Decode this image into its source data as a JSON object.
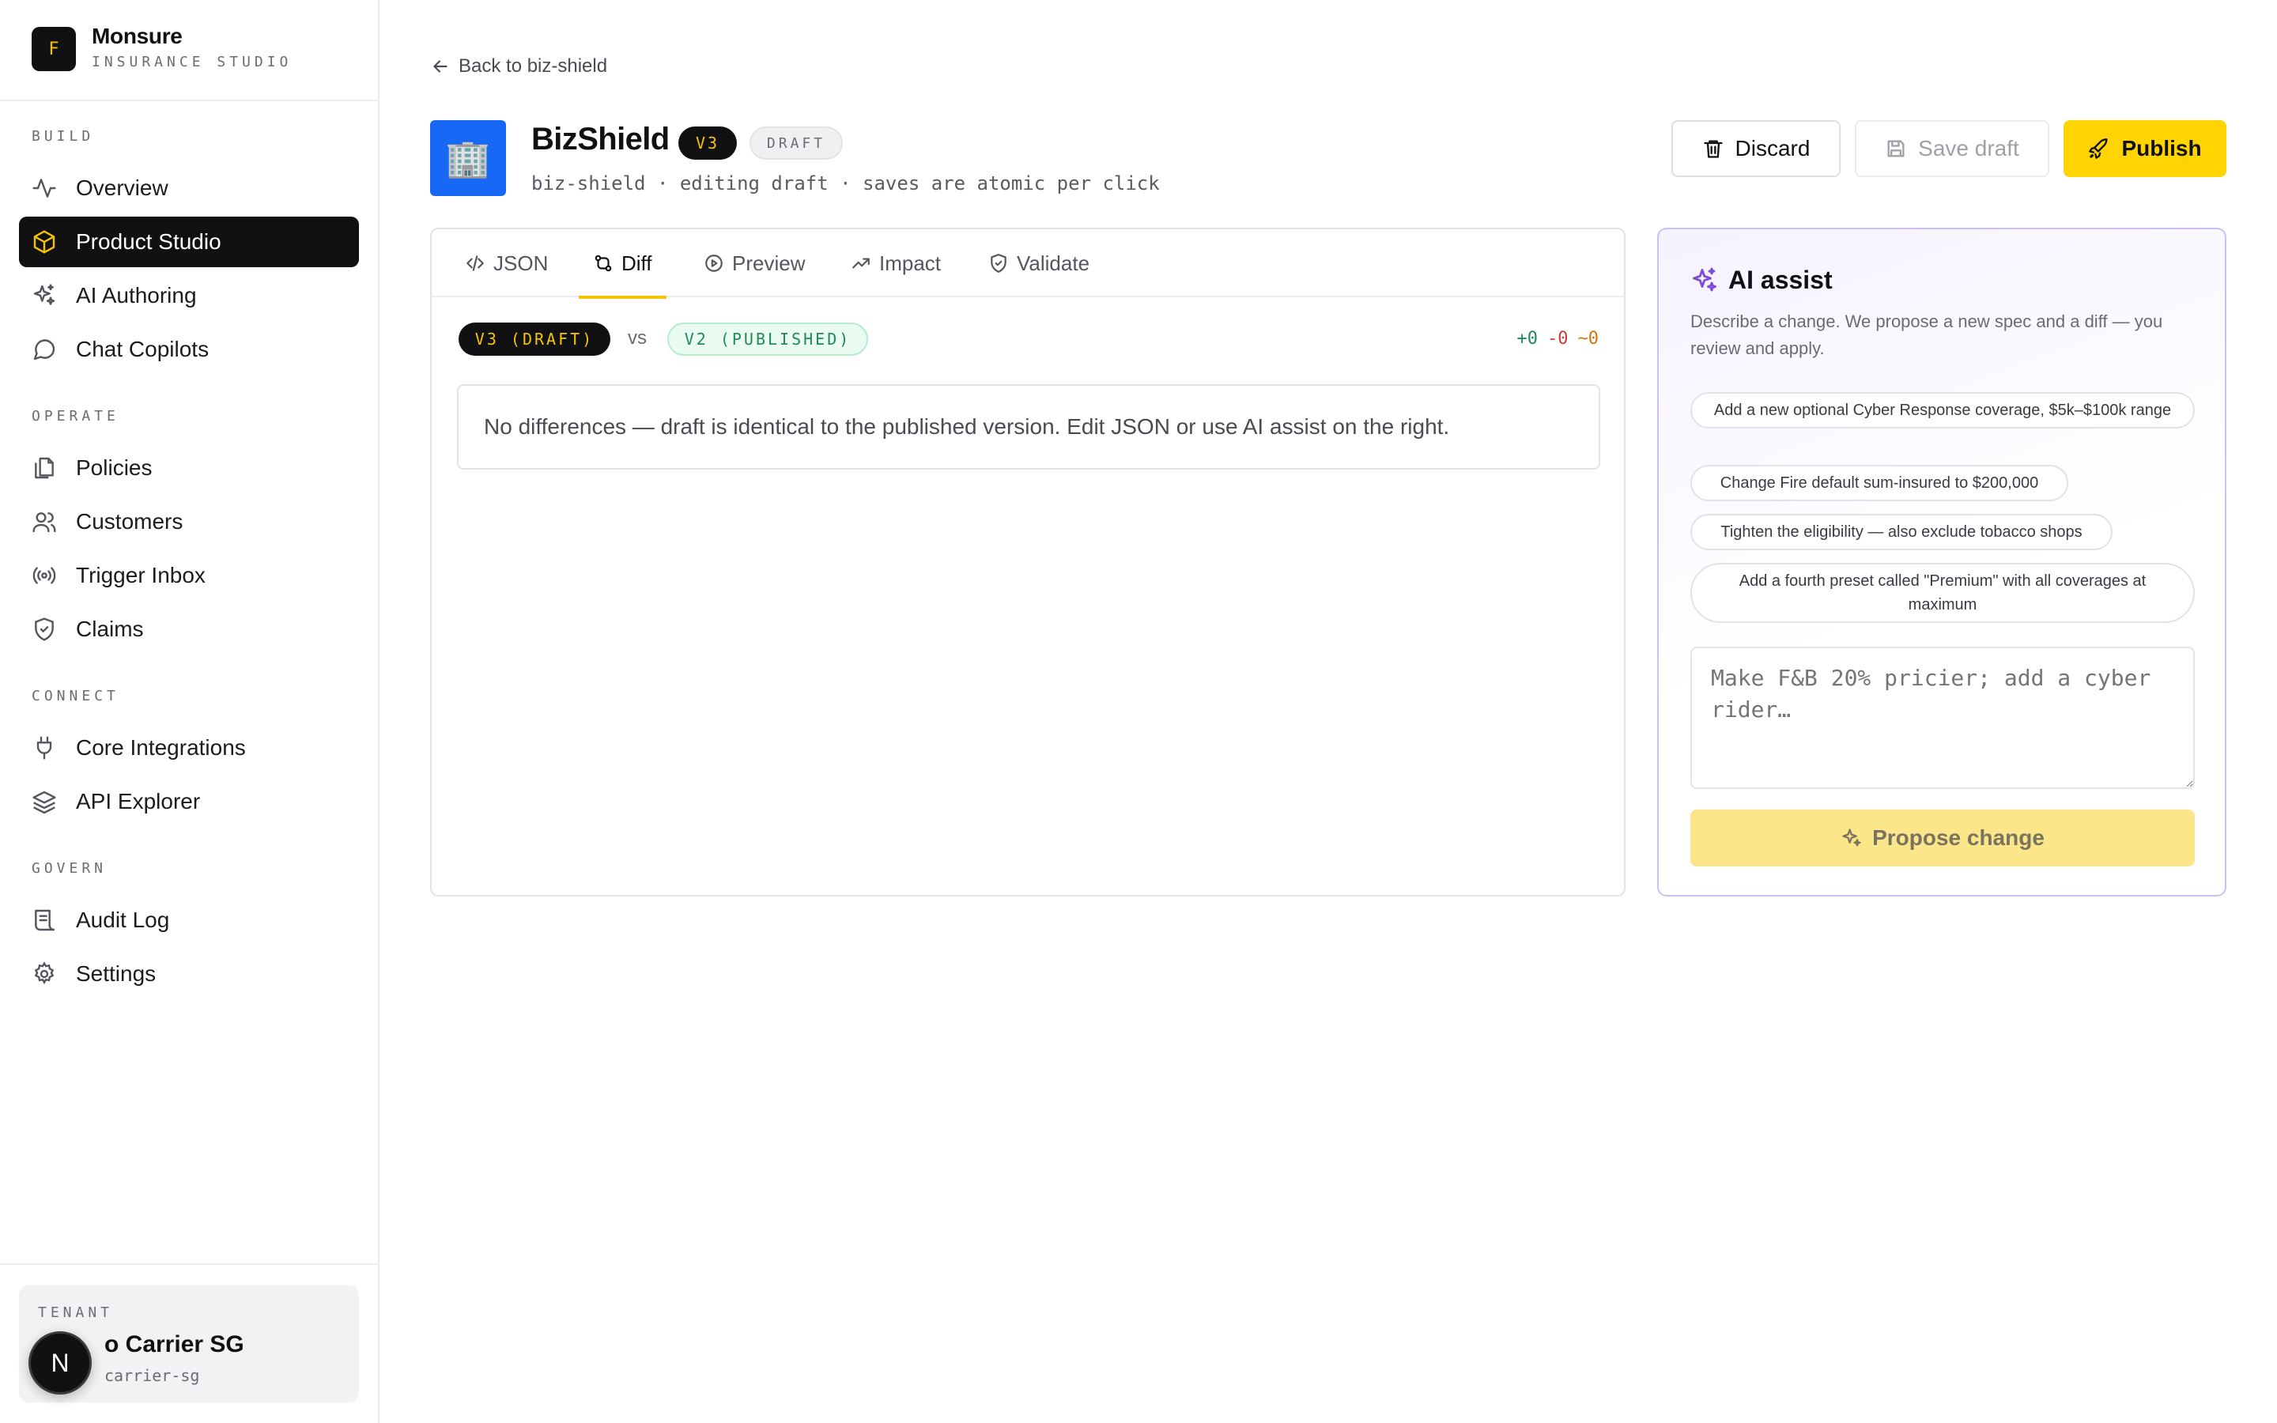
{
  "brand": {
    "logo_letter": "F",
    "name": "Monsure",
    "subtitle": "INSURANCE STUDIO"
  },
  "nav": {
    "sections": [
      {
        "label": "BUILD",
        "items": [
          {
            "label": "Overview",
            "icon": "activity-icon"
          },
          {
            "label": "Product Studio",
            "icon": "cube-icon",
            "active": true
          },
          {
            "label": "AI Authoring",
            "icon": "sparkles-icon"
          },
          {
            "label": "Chat Copilots",
            "icon": "chat-bubble-icon"
          }
        ]
      },
      {
        "label": "OPERATE",
        "items": [
          {
            "label": "Policies",
            "icon": "documents-icon"
          },
          {
            "label": "Customers",
            "icon": "users-icon"
          },
          {
            "label": "Trigger Inbox",
            "icon": "radio-signal-icon"
          },
          {
            "label": "Claims",
            "icon": "shield-check-icon"
          }
        ]
      },
      {
        "label": "CONNECT",
        "items": [
          {
            "label": "Core Integrations",
            "icon": "plug-icon"
          },
          {
            "label": "API Explorer",
            "icon": "layers-icon"
          }
        ]
      },
      {
        "label": "GOVERN",
        "items": [
          {
            "label": "Audit Log",
            "icon": "scroll-icon"
          },
          {
            "label": "Settings",
            "icon": "gear-icon"
          }
        ]
      }
    ]
  },
  "tenant": {
    "label": "TENANT",
    "name": "o Carrier SG",
    "slug": "carrier-sg"
  },
  "nextjs_badge": {
    "letter": "N"
  },
  "header": {
    "back_link": "Back to biz-shield",
    "product_emoji": "🏢",
    "title": "BizShield",
    "version": "V3",
    "status": "DRAFT",
    "subtitle": "biz-shield · editing draft · saves are atomic per click",
    "buttons": {
      "discard": "Discard",
      "save_draft": "Save draft",
      "publish": "Publish"
    }
  },
  "editor": {
    "tabs": [
      {
        "label": "JSON",
        "icon": "code-icon"
      },
      {
        "label": "Diff",
        "icon": "git-compare-icon",
        "active": true
      },
      {
        "label": "Preview",
        "icon": "play-circle-icon"
      },
      {
        "label": "Impact",
        "icon": "trending-up-icon"
      },
      {
        "label": "Validate",
        "icon": "shield-check-icon"
      }
    ],
    "diff": {
      "left": "V3 (DRAFT)",
      "vs": "vs",
      "right": "V2 (PUBLISHED)",
      "added": "+0",
      "removed": "-0",
      "modified": "~0",
      "empty_message": "No differences — draft is identical to the published version. Edit JSON or use AI assist on the right."
    }
  },
  "ai_assist": {
    "title": "AI assist",
    "description": "Describe a change. We propose a new spec and a diff — you review and apply.",
    "suggestions": [
      "Add a new optional Cyber Response coverage, $5k–$100k range",
      "Change Fire default sum-insured to $200,000",
      "Tighten the eligibility — also exclude tobacco shops",
      "Add a fourth preset called \"Premium\" with all coverages at maximum"
    ],
    "input_placeholder": "Make F&B 20% pricier; add a cyber rider…",
    "propose_label": "Propose change"
  },
  "colors": {
    "accent_yellow": "#ffd400",
    "sidebar_active_bg": "#111114",
    "product_icon_bg": "#1769f5",
    "ai_border": "#cbbff3",
    "diff_added": "#1f8a55",
    "diff_removed": "#d23b3b",
    "diff_modified": "#c77a12"
  }
}
